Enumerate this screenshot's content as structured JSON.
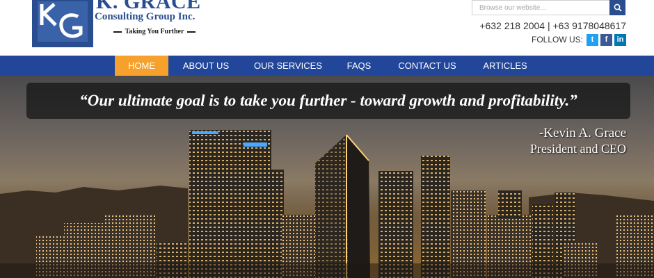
{
  "brand": {
    "logo_letters": "KG",
    "name": "K. GRACE",
    "subtitle": "Consulting Group Inc.",
    "tagline": "Taking You Further"
  },
  "search": {
    "placeholder": "Browse our website...",
    "icon": "search-icon"
  },
  "contact": {
    "phones": "+632 218 2004 | +63 9178048617",
    "follow_label": "FOLLOW US:",
    "social": [
      {
        "name": "twitter-icon",
        "glyph": "t",
        "color": "#1da1f2"
      },
      {
        "name": "facebook-icon",
        "glyph": "f",
        "color": "#3b5998"
      },
      {
        "name": "linkedin-icon",
        "glyph": "in",
        "color": "#0077b5"
      }
    ]
  },
  "nav": {
    "items": [
      {
        "label": "HOME",
        "active": true
      },
      {
        "label": "ABOUT US",
        "active": false
      },
      {
        "label": "OUR SERVICES",
        "active": false
      },
      {
        "label": "FAQS",
        "active": false
      },
      {
        "label": "CONTACT US",
        "active": false
      },
      {
        "label": "ARTICLES",
        "active": false
      }
    ],
    "bg_color": "#22469a",
    "active_color": "#f6a12c"
  },
  "hero": {
    "quote": "“Our ultimate goal is to take you further - toward growth and profitability.”",
    "author_name": "-Kevin A. Grace",
    "author_role": "President and CEO"
  },
  "colors": {
    "brand_blue": "#2a4d8f"
  }
}
